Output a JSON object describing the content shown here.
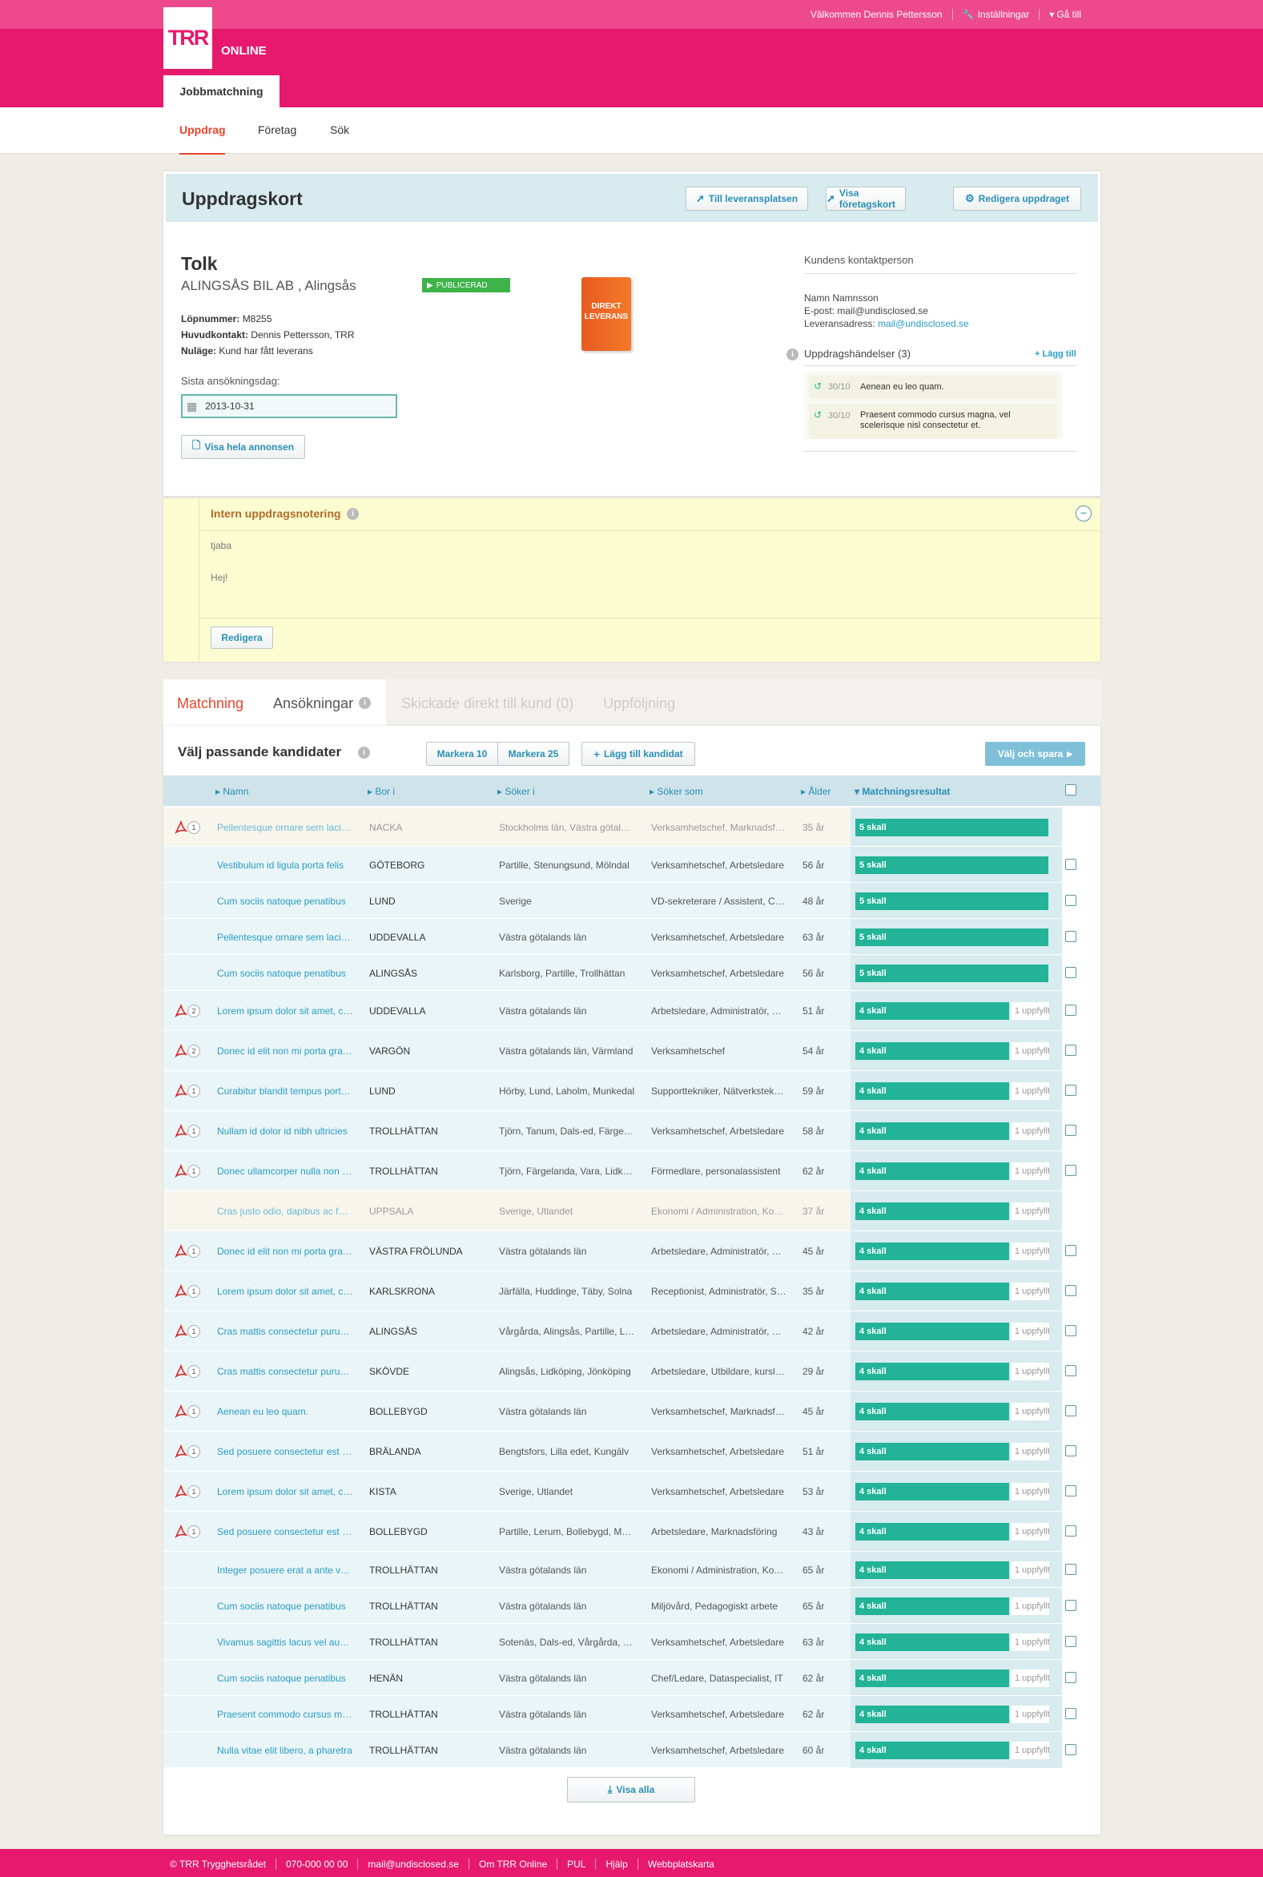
{
  "top": {
    "welcome": "Välkommen Dennis Pettersson",
    "settings": "Inställningar",
    "goto": "Gå till"
  },
  "brand": {
    "logo": "TRR",
    "online": "ONLINE",
    "accent": "#e6196d",
    "teal": "#22b398"
  },
  "app_tab": "Jobbmatchning",
  "subnav": [
    "Uppdrag",
    "Företag",
    "Sök"
  ],
  "card": {
    "title": "Uppdragskort",
    "buttons": [
      "Till leveransplatsen",
      "Visa företagskort",
      "Redigera uppdraget"
    ],
    "job_title": "Tolk",
    "company": "ALINGSÅS BIL AB , Alingsås",
    "status": "PUBLICERAD",
    "product": "DIREKT LEVERANS",
    "lopnummer_label": "Löpnummer:",
    "lopnummer": "M8255",
    "huvudkontakt_label": "Huvudkontakt:",
    "huvudkontakt": "Dennis Pettersson, TRR",
    "nulage_label": "Nuläge:",
    "nulage": "Kund har fått leverans",
    "deadline_label": "Sista ansökningsdag:",
    "deadline": "2013-10-31",
    "show_ad": "Visa hela annonsen",
    "contact_heading": "Kundens kontaktperson",
    "contact_name": "Namn Namnsson",
    "contact_email": "E-post: mail@undisclosed.se",
    "delivery_label": "Leveransadress:",
    "delivery_email": "mail@undisclosed.se",
    "events_heading": "Uppdragshändelser (3)",
    "events_add": "+ Lägg till",
    "events": [
      {
        "date": "30/10",
        "text": "Aenean eu leo quam."
      },
      {
        "date": "30/10",
        "text": "Praesent commodo cursus magna, vel scelerisque nisl consectetur et."
      }
    ]
  },
  "notes": {
    "heading": "Intern uppdragsnotering",
    "line1": "tjaba",
    "line2": "Hej!",
    "edit": "Redigera"
  },
  "tabs": [
    "Matchning",
    "Ansökningar",
    "Skickade direkt till kund (0)",
    "Uppföljning"
  ],
  "list": {
    "heading": "Välj passande kandidater",
    "mark10": "Markera 10",
    "mark25": "Markera 25",
    "add": "Lägg till kandidat",
    "save": "Välj och spara",
    "columns": [
      "Namn",
      "Bor i",
      "Söker i",
      "Söker som",
      "Ålder",
      "Matchningsresultat"
    ],
    "show_all": "Visa alla"
  },
  "rows": [
    {
      "name": "Pellentesque ornare sem lacinia",
      "bor": "NACKA",
      "soker_i": "Stockholms län, Västra götaland",
      "soker_som": "Verksamhetschef, Marknadsföring",
      "alder": "35 år",
      "match": "5 skall",
      "extra": "",
      "docs": "1",
      "pdf": true,
      "dim": true
    },
    {
      "name": "Vestibulum id ligula porta felis",
      "bor": "GÖTEBORG",
      "soker_i": "Partille, Stenungsund, Mölndal",
      "soker_som": "Verksamhetschef, Arbetsledare",
      "alder": "56 år",
      "match": "5 skall",
      "extra": "",
      "docs": "",
      "pdf": false,
      "dim": false
    },
    {
      "name": "Cum sociis natoque penatibus",
      "bor": "LUND",
      "soker_i": "Sverige",
      "soker_som": "VD-sekreterare / Assistent, Chef",
      "alder": "48 år",
      "match": "5 skall",
      "extra": "",
      "docs": "",
      "pdf": false,
      "dim": false
    },
    {
      "name": "Pellentesque ornare sem lacinia",
      "bor": "UDDEVALLA",
      "soker_i": "Västra götalands län",
      "soker_som": "Verksamhetschef, Arbetsledare",
      "alder": "63 år",
      "match": "5 skall",
      "extra": "",
      "docs": "",
      "pdf": false,
      "dim": false
    },
    {
      "name": "Cum sociis natoque penatibus",
      "bor": "ALINGSÅS",
      "soker_i": "Karlsborg, Partille, Trollhättan",
      "soker_som": "Verksamhetschef, Arbetsledare",
      "alder": "56 år",
      "match": "5 skall",
      "extra": "",
      "docs": "",
      "pdf": false,
      "dim": false
    },
    {
      "name": "Lorem ipsum dolor sit amet, consectetur",
      "bor": "UDDEVALLA",
      "soker_i": "Västra götalands län",
      "soker_som": "Arbetsledare, Administratör, Chef",
      "alder": "51 år",
      "match": "4 skall",
      "extra": "1 uppfyllt",
      "docs": "2",
      "pdf": true,
      "dim": false
    },
    {
      "name": "Donec id elit non mi porta gravida",
      "bor": "VARGÖN",
      "soker_i": "Västra götalands län, Värmland",
      "soker_som": "Verksamhetschef",
      "alder": "54 år",
      "match": "4 skall",
      "extra": "1 uppfyllt",
      "docs": "2",
      "pdf": true,
      "dim": false
    },
    {
      "name": "Curabitur blandit tempus porttitor",
      "bor": "LUND",
      "soker_i": "Hörby, Lund, Laholm, Munkedal",
      "soker_som": "Supporttekniker, Nätverkstekniker",
      "alder": "59 år",
      "match": "4 skall",
      "extra": "1 uppfyllt",
      "docs": "1",
      "pdf": true,
      "dim": false
    },
    {
      "name": "Nullam id dolor id nibh ultricies",
      "bor": "TROLLHÄTTAN",
      "soker_i": "Tjörn, Tanum, Dals-ed, Färgelanda",
      "soker_som": "Verksamhetschef, Arbetsledare",
      "alder": "58 år",
      "match": "4 skall",
      "extra": "1 uppfyllt",
      "docs": "1",
      "pdf": true,
      "dim": false
    },
    {
      "name": "Donec ullamcorper nulla non metus",
      "bor": "TROLLHÄTTAN",
      "soker_i": "Tjörn, Färgelanda, Vara, Lidköping",
      "soker_som": "Förmedlare, personalassistent",
      "alder": "62 år",
      "match": "4 skall",
      "extra": "1 uppfyllt",
      "docs": "1",
      "pdf": true,
      "dim": false
    },
    {
      "name": "Cras justo odio, dapibus ac facilisis",
      "bor": "UPPSALA",
      "soker_i": "Sverige, Utlandet",
      "soker_som": "Ekonomi / Administration, Konsult",
      "alder": "37 år",
      "match": "4 skall",
      "extra": "1 uppfyllt",
      "docs": "",
      "pdf": false,
      "dim": true
    },
    {
      "name": "Donec id elit non mi porta gravida",
      "bor": "VÄSTRA FRÖLUNDA",
      "soker_i": "Västra götalands län",
      "soker_som": "Arbetsledare, Administratör, Chef",
      "alder": "45 år",
      "match": "4 skall",
      "extra": "1 uppfyllt",
      "docs": "1",
      "pdf": true,
      "dim": false
    },
    {
      "name": "Lorem ipsum dolor sit amet, consectetur",
      "bor": "KARLSKRONA",
      "soker_i": "Järfälla, Huddinge, Täby, Solna",
      "soker_som": "Receptionist, Administratör, Sekreterare",
      "alder": "35 år",
      "match": "4 skall",
      "extra": "1 uppfyllt",
      "docs": "1",
      "pdf": true,
      "dim": false
    },
    {
      "name": "Cras mattis consectetur purus sit",
      "bor": "ALINGSÅS",
      "soker_i": "Vårgårda, Alingsås, Partille, Lerum",
      "soker_som": "Arbetsledare, Administratör, Chef",
      "alder": "42 år",
      "match": "4 skall",
      "extra": "1 uppfyllt",
      "docs": "1",
      "pdf": true,
      "dim": false
    },
    {
      "name": "Cras mattis consectetur purus sit",
      "bor": "SKÖVDE",
      "soker_i": "Alingsås, Lidköping, Jönköping",
      "soker_som": "Arbetsledare, Utbildare, kursledare",
      "alder": "29 år",
      "match": "4 skall",
      "extra": "1 uppfyllt",
      "docs": "1",
      "pdf": true,
      "dim": false
    },
    {
      "name": "Aenean eu leo quam.",
      "bor": "BOLLEBYGD",
      "soker_i": "Västra götalands län",
      "soker_som": "Verksamhetschef, Marknadsföring",
      "alder": "45 år",
      "match": "4 skall",
      "extra": "1 uppfyllt",
      "docs": "1",
      "pdf": true,
      "dim": false
    },
    {
      "name": "Sed posuere consectetur est at lobortis",
      "bor": "BRÄLANDA",
      "soker_i": "Bengtsfors, Lilla edet, Kungälv",
      "soker_som": "Verksamhetschef, Arbetsledare",
      "alder": "51 år",
      "match": "4 skall",
      "extra": "1 uppfyllt",
      "docs": "1",
      "pdf": true,
      "dim": false
    },
    {
      "name": "Lorem ipsum dolor sit amet, consectetur",
      "bor": "KISTA",
      "soker_i": "Sverige, Utlandet",
      "soker_som": "Verksamhetschef, Arbetsledare",
      "alder": "53 år",
      "match": "4 skall",
      "extra": "1 uppfyllt",
      "docs": "1",
      "pdf": true,
      "dim": false
    },
    {
      "name": "Sed posuere consectetur est at lobortis",
      "bor": "BOLLEBYGD",
      "soker_i": "Partille, Lerum, Bollebygd, Mark",
      "soker_som": "Arbetsledare, Marknadsföring",
      "alder": "43 år",
      "match": "4 skall",
      "extra": "1 uppfyllt",
      "docs": "1",
      "pdf": true,
      "dim": false
    },
    {
      "name": "Integer posuere erat a ante venenatis",
      "bor": "TROLLHÄTTAN",
      "soker_i": "Västra götalands län",
      "soker_som": "Ekonomi / Administration, Konsult",
      "alder": "65 år",
      "match": "4 skall",
      "extra": "1 uppfyllt",
      "docs": "",
      "pdf": false,
      "dim": false
    },
    {
      "name": "Cum sociis natoque penatibus",
      "bor": "TROLLHÄTTAN",
      "soker_i": "Västra götalands län",
      "soker_som": "Miljövård, Pedagogiskt arbete",
      "alder": "65 år",
      "match": "4 skall",
      "extra": "1 uppfyllt",
      "docs": "",
      "pdf": false,
      "dim": false
    },
    {
      "name": "Vivamus sagittis lacus vel augue",
      "bor": "TROLLHÄTTAN",
      "soker_i": "Sotenäs, Dals-ed, Vårgårda, Lerum",
      "soker_som": "Verksamhetschef, Arbetsledare",
      "alder": "63 år",
      "match": "4 skall",
      "extra": "1 uppfyllt",
      "docs": "",
      "pdf": false,
      "dim": false
    },
    {
      "name": "Cum sociis natoque penatibus",
      "bor": "HENÄN",
      "soker_i": "Västra götalands län",
      "soker_som": "Chef/Ledare, Dataspecialist, IT",
      "alder": "62 år",
      "match": "4 skall",
      "extra": "1 uppfyllt",
      "docs": "",
      "pdf": false,
      "dim": false
    },
    {
      "name": "Praesent commodo cursus magna",
      "bor": "TROLLHÄTTAN",
      "soker_i": "Västra götalands län",
      "soker_som": "Verksamhetschef, Arbetsledare",
      "alder": "62 år",
      "match": "4 skall",
      "extra": "1 uppfyllt",
      "docs": "",
      "pdf": false,
      "dim": false
    },
    {
      "name": "Nulla vitae elit libero, a pharetra",
      "bor": "TROLLHÄTTAN",
      "soker_i": "Västra götalands län",
      "soker_som": "Verksamhetschef, Arbetsledare",
      "alder": "60 år",
      "match": "4 skall",
      "extra": "1 uppfyllt",
      "docs": "",
      "pdf": false,
      "dim": false
    }
  ],
  "footer": [
    "© TRR Trygghetsrådet",
    "070-000 00 00",
    "mail@undisclosed.se",
    "Om TRR Online",
    "PUL",
    "Hjälp",
    "Webbplatskarta"
  ]
}
